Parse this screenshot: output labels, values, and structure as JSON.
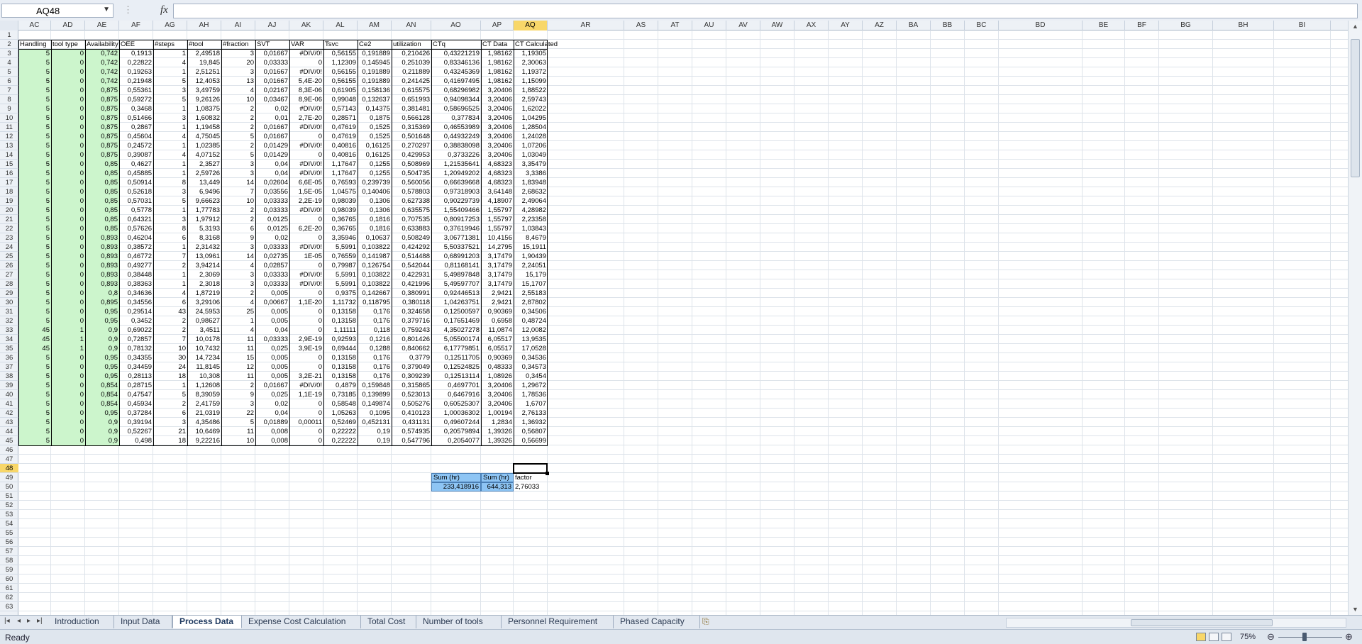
{
  "name_box": "AQ48",
  "formula_icon": "fx",
  "formula_value": "",
  "active_cell": {
    "col": "AQ",
    "row": 48
  },
  "columns": [
    {
      "l": "AC",
      "w": 46
    },
    {
      "l": "AD",
      "w": 48
    },
    {
      "l": "AE",
      "w": 48
    },
    {
      "l": "AF",
      "w": 48
    },
    {
      "l": "AG",
      "w": 48
    },
    {
      "l": "AH",
      "w": 48
    },
    {
      "l": "AI",
      "w": 48
    },
    {
      "l": "AJ",
      "w": 48
    },
    {
      "l": "AK",
      "w": 48
    },
    {
      "l": "AL",
      "w": 48
    },
    {
      "l": "AM",
      "w": 48
    },
    {
      "l": "AN",
      "w": 56
    },
    {
      "l": "AO",
      "w": 70
    },
    {
      "l": "AP",
      "w": 46
    },
    {
      "l": "AQ",
      "w": 48
    },
    {
      "l": "AR",
      "w": 108
    },
    {
      "l": "AS",
      "w": 48
    },
    {
      "l": "AT",
      "w": 48
    },
    {
      "l": "AU",
      "w": 48
    },
    {
      "l": "AV",
      "w": 48
    },
    {
      "l": "AW",
      "w": 48
    },
    {
      "l": "AX",
      "w": 48
    },
    {
      "l": "AY",
      "w": 48
    },
    {
      "l": "AZ",
      "w": 48
    },
    {
      "l": "BA",
      "w": 48
    },
    {
      "l": "BB",
      "w": 48
    },
    {
      "l": "BC",
      "w": 48
    },
    {
      "l": "BD",
      "w": 118
    },
    {
      "l": "BE",
      "w": 60
    },
    {
      "l": "BF",
      "w": 48
    },
    {
      "l": "BG",
      "w": 76
    },
    {
      "l": "BH",
      "w": 86
    },
    {
      "l": "BI",
      "w": 80
    }
  ],
  "row_numbers": [
    "1",
    "2",
    "3",
    "4",
    "5",
    "6",
    "7",
    "8",
    "9",
    "10",
    "11",
    "12",
    "13",
    "14",
    "15",
    "16",
    "17",
    "18",
    "19",
    "20",
    "21",
    "22",
    "23",
    "24",
    "25",
    "26",
    "27",
    "28",
    "29",
    "30",
    "31",
    "32",
    "33",
    "34",
    "35",
    "36",
    "37",
    "38",
    "39",
    "40",
    "41",
    "42",
    "43",
    "44",
    "45",
    "46",
    "47",
    "48",
    "49",
    "50",
    "51",
    "52",
    "53",
    "54",
    "55",
    "56",
    "57",
    "58",
    "59",
    "60",
    "61",
    "62",
    "63"
  ],
  "headers": [
    "Handling",
    "tool type",
    "Availability",
    "OEE",
    "#steps",
    "#tool",
    "#fraction",
    "SVT",
    "VAR",
    "Tsvc",
    "Ce2",
    "utilization",
    "CTq",
    "CT Data",
    "CT Calculated"
  ],
  "rows": [
    [
      "5",
      "0",
      "0,742",
      "0,1913",
      "1",
      "2,49518",
      "3",
      "0,01667",
      "#DIV/0!",
      "0,56155",
      "0,191889",
      "0,210426",
      "0,43221219",
      "1,98162",
      "1,19305"
    ],
    [
      "5",
      "0",
      "0,742",
      "0,22822",
      "4",
      "19,845",
      "20",
      "0,03333",
      "0",
      "1,12309",
      "0,145945",
      "0,251039",
      "0,83346136",
      "1,98162",
      "2,30063"
    ],
    [
      "5",
      "0",
      "0,742",
      "0,19263",
      "1",
      "2,51251",
      "3",
      "0,01667",
      "#DIV/0!",
      "0,56155",
      "0,191889",
      "0,211889",
      "0,43245369",
      "1,98162",
      "1,19372"
    ],
    [
      "5",
      "0",
      "0,742",
      "0,21948",
      "5",
      "12,4053",
      "13",
      "0,01667",
      "5,4E-20",
      "0,56155",
      "0,191889",
      "0,241425",
      "0,41697495",
      "1,98162",
      "1,15099"
    ],
    [
      "5",
      "0",
      "0,875",
      "0,55361",
      "3",
      "3,49759",
      "4",
      "0,02167",
      "8,3E-06",
      "0,61905",
      "0,158136",
      "0,615575",
      "0,68296982",
      "3,20406",
      "1,88522"
    ],
    [
      "5",
      "0",
      "0,875",
      "0,59272",
      "5",
      "9,26126",
      "10",
      "0,03467",
      "8,9E-06",
      "0,99048",
      "0,132637",
      "0,651993",
      "0,94098344",
      "3,20406",
      "2,59743"
    ],
    [
      "5",
      "0",
      "0,875",
      "0,3468",
      "1",
      "1,08375",
      "2",
      "0,02",
      "#DIV/0!",
      "0,57143",
      "0,14375",
      "0,381481",
      "0,58696525",
      "3,20406",
      "1,62022"
    ],
    [
      "5",
      "0",
      "0,875",
      "0,51466",
      "3",
      "1,60832",
      "2",
      "0,01",
      "2,7E-20",
      "0,28571",
      "0,1875",
      "0,566128",
      "0,377834",
      "3,20406",
      "1,04295"
    ],
    [
      "5",
      "0",
      "0,875",
      "0,2867",
      "1",
      "1,19458",
      "2",
      "0,01667",
      "#DIV/0!",
      "0,47619",
      "0,1525",
      "0,315369",
      "0,46553989",
      "3,20406",
      "1,28504"
    ],
    [
      "5",
      "0",
      "0,875",
      "0,45604",
      "4",
      "4,75045",
      "5",
      "0,01667",
      "0",
      "0,47619",
      "0,1525",
      "0,501648",
      "0,44932249",
      "3,20406",
      "1,24028"
    ],
    [
      "5",
      "0",
      "0,875",
      "0,24572",
      "1",
      "1,02385",
      "2",
      "0,01429",
      "#DIV/0!",
      "0,40816",
      "0,16125",
      "0,270297",
      "0,38838098",
      "3,20406",
      "1,07206"
    ],
    [
      "5",
      "0",
      "0,875",
      "0,39087",
      "4",
      "4,07152",
      "5",
      "0,01429",
      "0",
      "0,40816",
      "0,16125",
      "0,429953",
      "0,3733226",
      "3,20406",
      "1,03049"
    ],
    [
      "5",
      "0",
      "0,85",
      "0,4627",
      "1",
      "2,3527",
      "3",
      "0,04",
      "#DIV/0!",
      "1,17647",
      "0,1255",
      "0,508969",
      "1,21535641",
      "4,68323",
      "3,35479"
    ],
    [
      "5",
      "0",
      "0,85",
      "0,45885",
      "1",
      "2,59726",
      "3",
      "0,04",
      "#DIV/0!",
      "1,17647",
      "0,1255",
      "0,504735",
      "1,20949202",
      "4,68323",
      "3,3386"
    ],
    [
      "5",
      "0",
      "0,85",
      "0,50914",
      "8",
      "13,449",
      "14",
      "0,02604",
      "6,6E-05",
      "0,76593",
      "0,239739",
      "0,560056",
      "0,66639668",
      "4,68323",
      "1,83948"
    ],
    [
      "5",
      "0",
      "0,85",
      "0,52618",
      "3",
      "6,9496",
      "7",
      "0,03556",
      "1,5E-05",
      "1,04575",
      "0,140406",
      "0,578803",
      "0,97318903",
      "3,64148",
      "2,68632"
    ],
    [
      "5",
      "0",
      "0,85",
      "0,57031",
      "5",
      "9,66623",
      "10",
      "0,03333",
      "2,2E-19",
      "0,98039",
      "0,1306",
      "0,627338",
      "0,90229739",
      "4,18907",
      "2,49064"
    ],
    [
      "5",
      "0",
      "0,85",
      "0,5778",
      "1",
      "1,77783",
      "2",
      "0,03333",
      "#DIV/0!",
      "0,98039",
      "0,1306",
      "0,635575",
      "1,55409466",
      "1,55797",
      "4,28982"
    ],
    [
      "5",
      "0",
      "0,85",
      "0,64321",
      "3",
      "1,97912",
      "2",
      "0,0125",
      "0",
      "0,36765",
      "0,1816",
      "0,707535",
      "0,80917253",
      "1,55797",
      "2,23358"
    ],
    [
      "5",
      "0",
      "0,85",
      "0,57626",
      "8",
      "5,3193",
      "6",
      "0,0125",
      "6,2E-20",
      "0,36765",
      "0,1816",
      "0,633883",
      "0,37619946",
      "1,55797",
      "1,03843"
    ],
    [
      "5",
      "0",
      "0,893",
      "0,46204",
      "6",
      "8,3168",
      "9",
      "0,02",
      "0",
      "3,35946",
      "0,10637",
      "0,508249",
      "3,06771381",
      "10,4156",
      "8,4679"
    ],
    [
      "5",
      "0",
      "0,893",
      "0,38572",
      "1",
      "2,31432",
      "3",
      "0,03333",
      "#DIV/0!",
      "5,5991",
      "0,103822",
      "0,424292",
      "5,50337521",
      "14,2795",
      "15,1911"
    ],
    [
      "5",
      "0",
      "0,893",
      "0,46772",
      "7",
      "13,0961",
      "14",
      "0,02735",
      "1E-05",
      "0,76559",
      "0,141987",
      "0,514488",
      "0,68991203",
      "3,17479",
      "1,90439"
    ],
    [
      "5",
      "0",
      "0,893",
      "0,49277",
      "2",
      "3,94214",
      "4",
      "0,02857",
      "0",
      "0,79987",
      "0,126754",
      "0,542044",
      "0,81168141",
      "3,17479",
      "2,24051"
    ],
    [
      "5",
      "0",
      "0,893",
      "0,38448",
      "1",
      "2,3069",
      "3",
      "0,03333",
      "#DIV/0!",
      "5,5991",
      "0,103822",
      "0,422931",
      "5,49897848",
      "3,17479",
      "15,179"
    ],
    [
      "5",
      "0",
      "0,893",
      "0,38363",
      "1",
      "2,3018",
      "3",
      "0,03333",
      "#DIV/0!",
      "5,5991",
      "0,103822",
      "0,421996",
      "5,49597707",
      "3,17479",
      "15,1707"
    ],
    [
      "5",
      "0",
      "0,8",
      "0,34636",
      "4",
      "1,87219",
      "2",
      "0,005",
      "0",
      "0,9375",
      "0,142667",
      "0,380991",
      "0,92446513",
      "2,9421",
      "2,55183"
    ],
    [
      "5",
      "0",
      "0,895",
      "0,34556",
      "6",
      "3,29106",
      "4",
      "0,00667",
      "1,1E-20",
      "1,11732",
      "0,118795",
      "0,380118",
      "1,04263751",
      "2,9421",
      "2,87802"
    ],
    [
      "5",
      "0",
      "0,95",
      "0,29514",
      "43",
      "24,5953",
      "25",
      "0,005",
      "0",
      "0,13158",
      "0,176",
      "0,324658",
      "0,12500597",
      "0,90369",
      "0,34506"
    ],
    [
      "5",
      "0",
      "0,95",
      "0,3452",
      "2",
      "0,98627",
      "1",
      "0,005",
      "0",
      "0,13158",
      "0,176",
      "0,379716",
      "0,17651469",
      "0,6958",
      "0,48724"
    ],
    [
      "45",
      "1",
      "0,9",
      "0,69022",
      "2",
      "3,4511",
      "4",
      "0,04",
      "0",
      "1,11111",
      "0,118",
      "0,759243",
      "4,35027278",
      "11,0874",
      "12,0082"
    ],
    [
      "45",
      "1",
      "0,9",
      "0,72857",
      "7",
      "10,0178",
      "11",
      "0,03333",
      "2,9E-19",
      "0,92593",
      "0,1216",
      "0,801426",
      "5,05500174",
      "6,05517",
      "13,9535"
    ],
    [
      "45",
      "1",
      "0,9",
      "0,78132",
      "10",
      "10,7432",
      "11",
      "0,025",
      "3,9E-19",
      "0,69444",
      "0,1288",
      "0,840662",
      "6,17779851",
      "6,05517",
      "17,0528"
    ],
    [
      "5",
      "0",
      "0,95",
      "0,34355",
      "30",
      "14,7234",
      "15",
      "0,005",
      "0",
      "0,13158",
      "0,176",
      "0,3779",
      "0,12511705",
      "0,90369",
      "0,34536"
    ],
    [
      "5",
      "0",
      "0,95",
      "0,34459",
      "24",
      "11,8145",
      "12",
      "0,005",
      "0",
      "0,13158",
      "0,176",
      "0,379049",
      "0,12524825",
      "0,48333",
      "0,34573"
    ],
    [
      "5",
      "0",
      "0,95",
      "0,28113",
      "18",
      "10,308",
      "11",
      "0,005",
      "3,2E-21",
      "0,13158",
      "0,176",
      "0,309239",
      "0,12513114",
      "1,08926",
      "0,3454"
    ],
    [
      "5",
      "0",
      "0,854",
      "0,28715",
      "1",
      "1,12608",
      "2",
      "0,01667",
      "#DIV/0!",
      "0,4879",
      "0,159848",
      "0,315865",
      "0,4697701",
      "3,20406",
      "1,29672"
    ],
    [
      "5",
      "0",
      "0,854",
      "0,47547",
      "5",
      "8,39059",
      "9",
      "0,025",
      "1,1E-19",
      "0,73185",
      "0,139899",
      "0,523013",
      "0,6467916",
      "3,20406",
      "1,78536"
    ],
    [
      "5",
      "0",
      "0,854",
      "0,45934",
      "2",
      "2,41759",
      "3",
      "0,02",
      "0",
      "0,58548",
      "0,149874",
      "0,505276",
      "0,60525307",
      "3,20406",
      "1,6707"
    ],
    [
      "5",
      "0",
      "0,95",
      "0,37284",
      "6",
      "21,0319",
      "22",
      "0,04",
      "0",
      "1,05263",
      "0,1095",
      "0,410123",
      "1,00036302",
      "1,00194",
      "2,76133"
    ],
    [
      "5",
      "0",
      "0,9",
      "0,39194",
      "3",
      "4,35486",
      "5",
      "0,01889",
      "0,00011",
      "0,52469",
      "0,452131",
      "0,431131",
      "0,49607244",
      "1,2834",
      "1,36932"
    ],
    [
      "5",
      "0",
      "0,9",
      "0,52267",
      "21",
      "10,6469",
      "11",
      "0,008",
      "0",
      "0,22222",
      "0,19",
      "0,574935",
      "0,20579894",
      "1,39326",
      "0,56807"
    ],
    [
      "5",
      "0",
      "0,9",
      "0,498",
      "18",
      "9,22216",
      "10",
      "0,008",
      "0",
      "0,22222",
      "0,19",
      "0,547796",
      "0,2054077",
      "1,39326",
      "0,56699"
    ]
  ],
  "summary": {
    "label_sum1": "Sum (hr)",
    "label_sum2": "Sum (hr)",
    "label_factor": "factor",
    "value_sum1": "233,418916",
    "value_sum2": "644,313",
    "value_factor": "2,76033"
  },
  "sheet_nav": [
    "|◂",
    "◂",
    "▸",
    "▸|"
  ],
  "sheet_tabs": [
    "Introduction",
    "Input Data",
    "Process Data",
    "Expense Cost Calculation",
    "Total Cost",
    "Number of tools",
    "Personnel Requirement",
    "Phased Capacity"
  ],
  "active_sheet": "Process Data",
  "status": {
    "ready": "Ready",
    "zoom": "75%"
  },
  "colors": {
    "accent_header": "#f8d769",
    "green_fill": "#ccf5cc",
    "sum_fill": "#8ec5f4"
  }
}
